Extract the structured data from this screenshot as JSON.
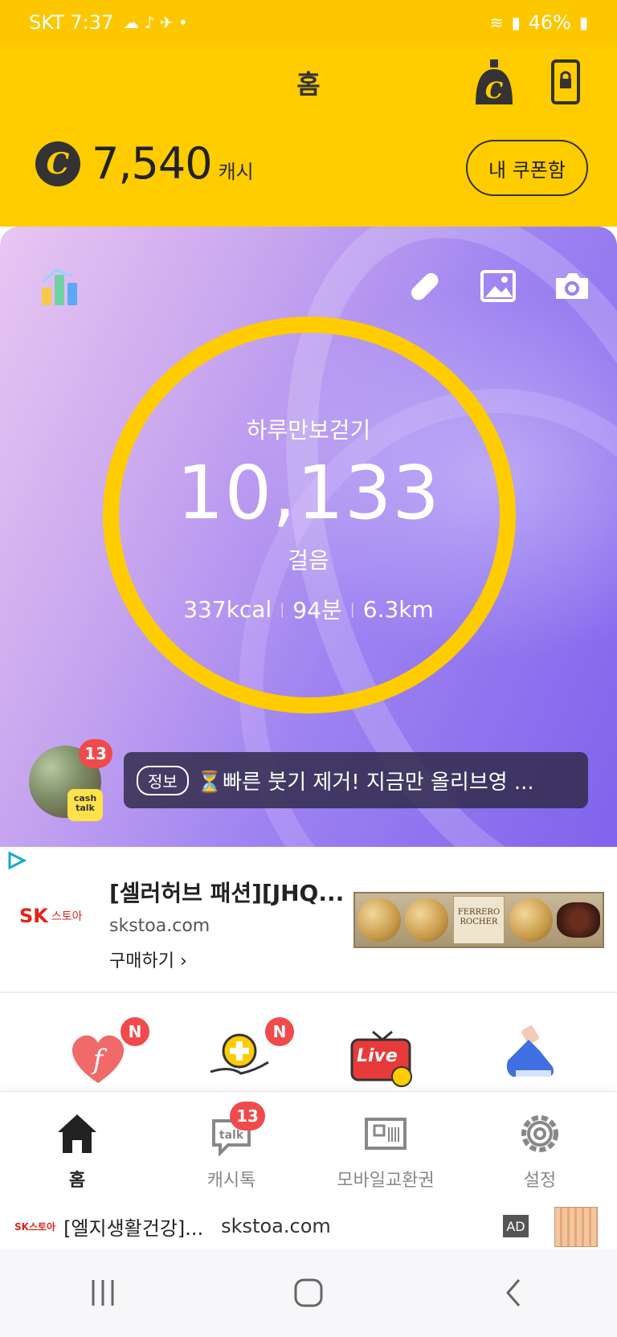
{
  "status_bar": {
    "carrier_time": "SKT 7:37",
    "battery": "46%"
  },
  "header": {
    "title": "홈",
    "cash_amount": "7,540",
    "cash_unit": "캐시",
    "coupon_button": "내 쿠폰함",
    "coin_symbol": "C"
  },
  "hero": {
    "label": "하루만보걷기",
    "steps": "10,133",
    "unit": "걸음",
    "kcal": "337kcal",
    "minutes": "94분",
    "distance": "6.3km",
    "cashtalk_badge": "13",
    "cashtalk_logo": "cash talk",
    "notice_tag": "정보",
    "notice_text": "⏳빠른 붓기 제거! 지금만 올리브영 ..."
  },
  "ad": {
    "title": "[셀러허브 패션][JHQ...",
    "domain": "skstoa.com",
    "cta": "구매하기 ›",
    "logo_sk": "SK",
    "logo_store": "스토아",
    "product_brand": "FERRERO ROCHER"
  },
  "quick": {
    "badge1": "N",
    "badge2": "N",
    "live_label": "Live"
  },
  "bottom_nav": {
    "items": [
      {
        "label": "홈"
      },
      {
        "label": "캐시톡",
        "badge": "13"
      },
      {
        "label": "모바일교환권"
      },
      {
        "label": "설정"
      }
    ]
  },
  "ad_strip": {
    "logo": "SK스토아",
    "title": "[엘지생활건강]...",
    "domain": "skstoa.com",
    "ad_label": "AD"
  },
  "colors": {
    "brand_yellow": "#ffcc00",
    "badge_red": "#f04a4a",
    "hero_purple": "#8f74ef"
  }
}
